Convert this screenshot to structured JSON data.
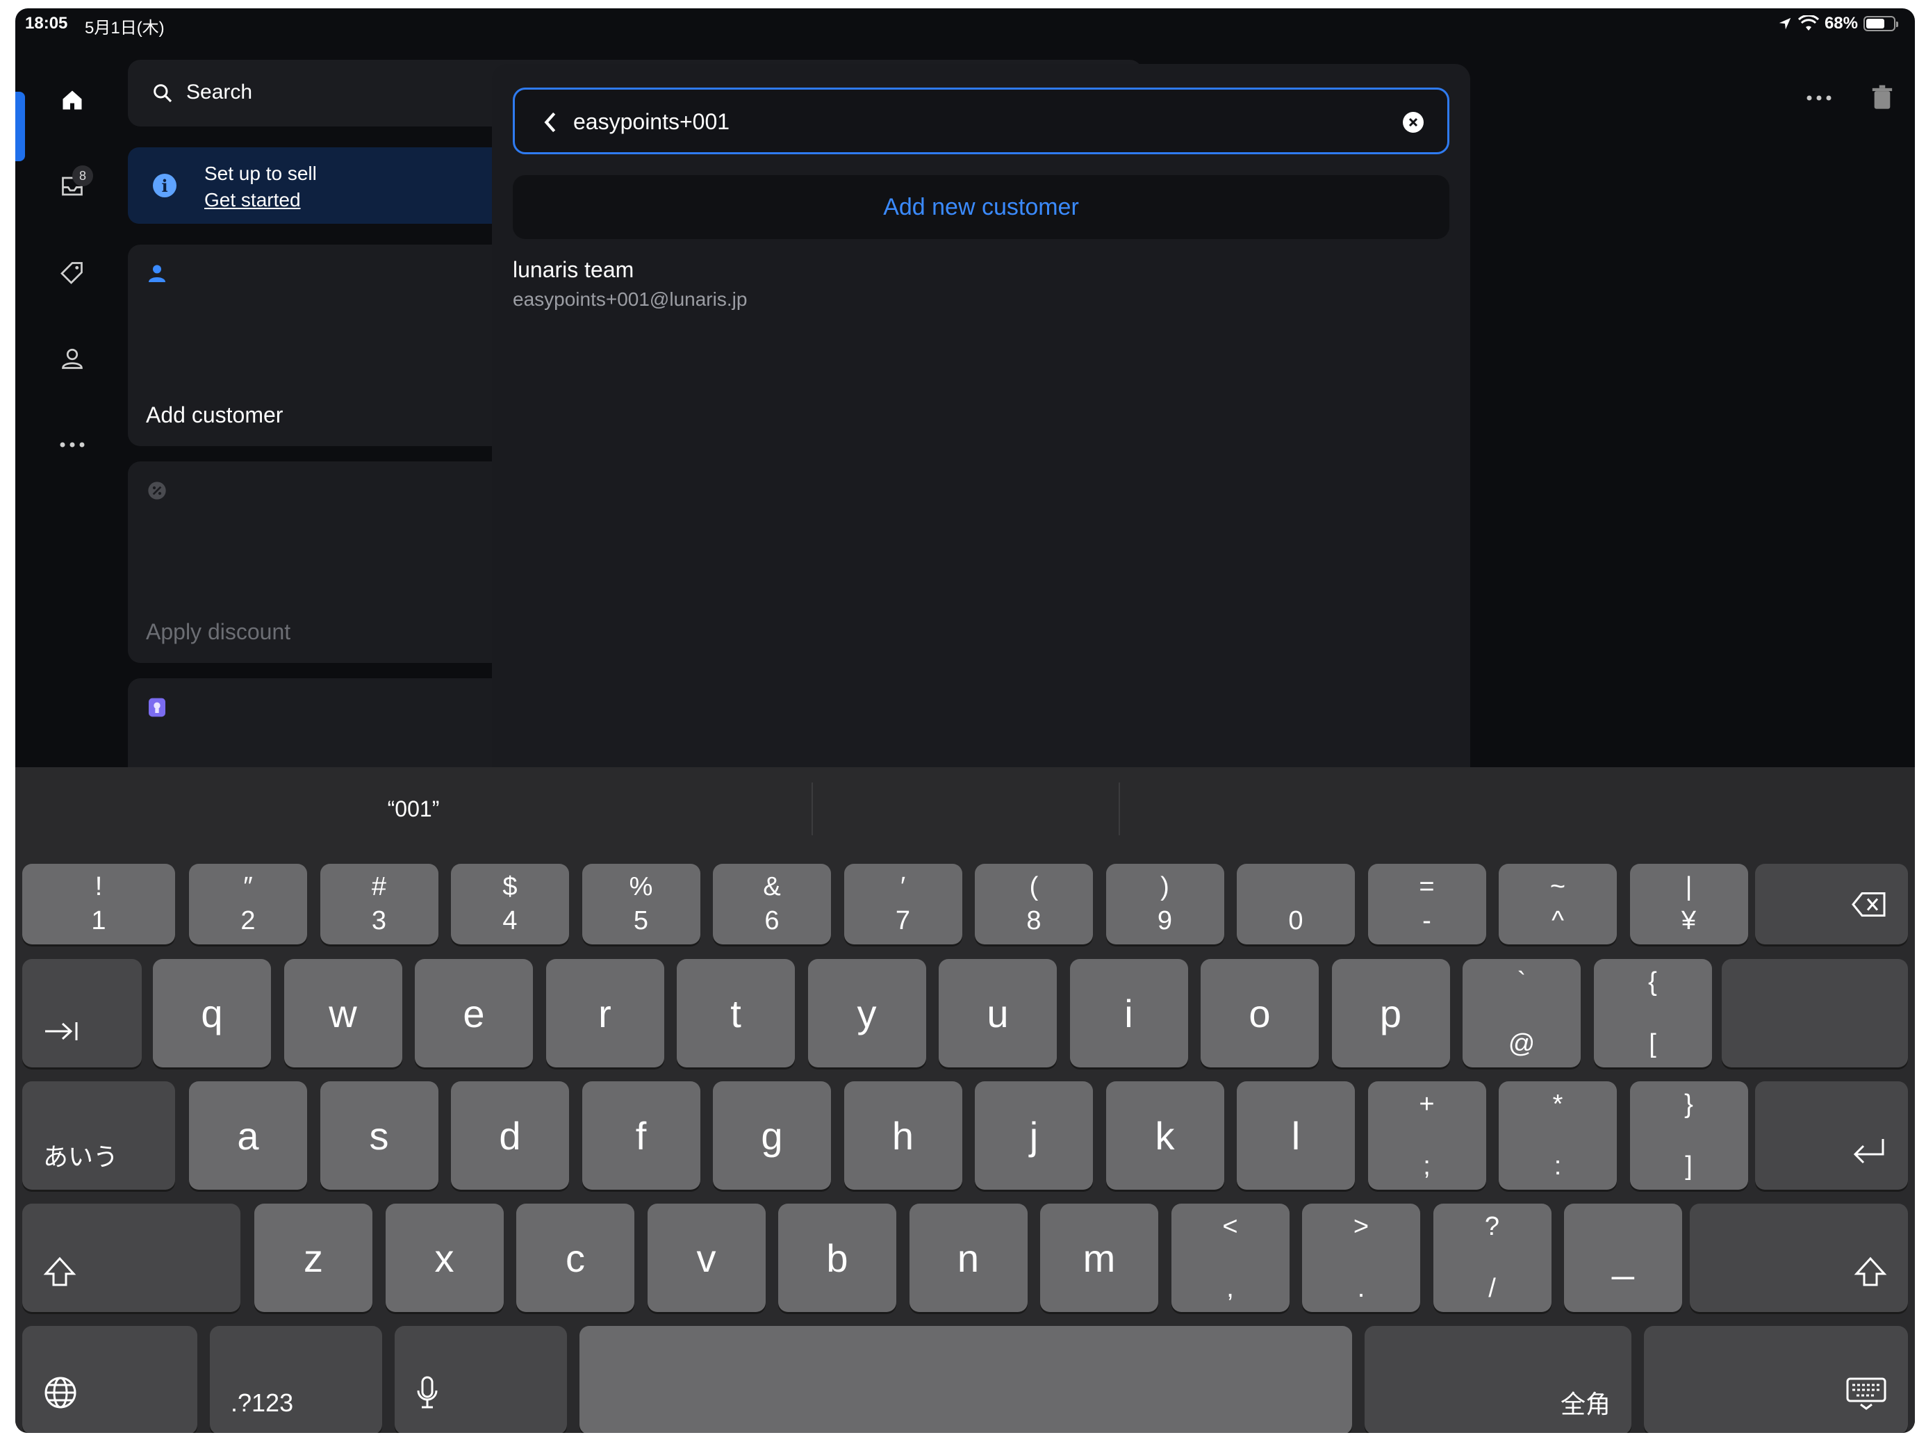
{
  "status_bar": {
    "time": "18:05",
    "date": "5月1日(木)",
    "battery": "68%",
    "battery_level": 0.68
  },
  "sidebar": {
    "inbox_badge": "8"
  },
  "main": {
    "search_label": "Search",
    "setup": {
      "title": "Set up to sell",
      "link": "Get started"
    },
    "tiles": {
      "add_customer": "Add customer",
      "apply_discount": "Apply discount"
    }
  },
  "modal": {
    "search_value": "easypoints+001",
    "add_new_customer": "Add new customer",
    "results": [
      {
        "name": "lunaris team",
        "email": "easypoints+001@lunaris.jp"
      }
    ]
  },
  "keyboard": {
    "suggestion": "“001”",
    "row1": [
      {
        "top": "!",
        "bot": "1"
      },
      {
        "top": "″",
        "bot": "2"
      },
      {
        "top": "#",
        "bot": "3"
      },
      {
        "top": "$",
        "bot": "4"
      },
      {
        "top": "%",
        "bot": "5"
      },
      {
        "top": "&",
        "bot": "6"
      },
      {
        "top": "′",
        "bot": "7"
      },
      {
        "top": "(",
        "bot": "8"
      },
      {
        "top": ")",
        "bot": "9"
      },
      {
        "top": "",
        "bot": "0"
      },
      {
        "top": "=",
        "bot": "-"
      },
      {
        "top": "~",
        "bot": "^"
      },
      {
        "top": "|",
        "bot": "¥"
      }
    ],
    "row2": [
      "q",
      "w",
      "e",
      "r",
      "t",
      "y",
      "u",
      "i",
      "o",
      "p"
    ],
    "row2_extra": [
      {
        "top": "`",
        "bot": "@"
      },
      {
        "top": "{",
        "bot": "["
      }
    ],
    "row3": [
      "a",
      "s",
      "d",
      "f",
      "g",
      "h",
      "j",
      "k",
      "l"
    ],
    "row3_extra": [
      {
        "top": "+",
        "bot": ";"
      },
      {
        "top": "*",
        "bot": ":"
      },
      {
        "top": "}",
        "bot": "]"
      }
    ],
    "row4": [
      "z",
      "x",
      "c",
      "v",
      "b",
      "n",
      "m"
    ],
    "row4_extra": [
      {
        "top": "<",
        "bot": ","
      },
      {
        "top": ">",
        "bot": "."
      },
      {
        "top": "?",
        "bot": "/"
      }
    ],
    "underscore": "_",
    "kana_label": "あいう",
    "numbers_label": ".?123",
    "zenkaku_label": "全角"
  }
}
